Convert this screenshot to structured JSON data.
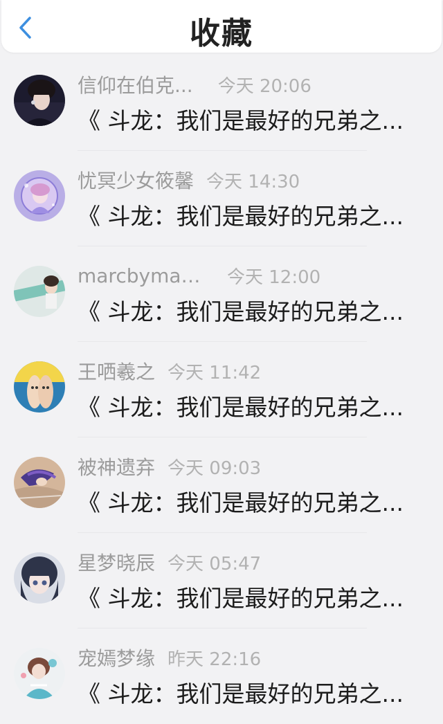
{
  "header": {
    "title": "收藏",
    "accent": "#3d8fe0"
  },
  "items": [
    {
      "name": "信仰在伯克...",
      "time": "今天 20:06",
      "message": "《 斗龙：我们是最好的兄弟之..."
    },
    {
      "name": "忧冥少女筱馨",
      "time": "今天 14:30",
      "message": "《 斗龙：我们是最好的兄弟之..."
    },
    {
      "name": "marcbymar...",
      "time": "今天 12:00",
      "message": "《 斗龙：我们是最好的兄弟之..."
    },
    {
      "name": "王哂羲之",
      "time": "今天 11:42",
      "message": "《 斗龙：我们是最好的兄弟之..."
    },
    {
      "name": "被神遗弃",
      "time": "今天 09:03",
      "message": "《 斗龙：我们是最好的兄弟之..."
    },
    {
      "name": "星梦晓辰",
      "time": "今天 05:47",
      "message": "《 斗龙：我们是最好的兄弟之..."
    },
    {
      "name": "宠嫣梦缘",
      "time": "昨天 22:16",
      "message": "《 斗龙：我们是最好的兄弟之..."
    }
  ]
}
